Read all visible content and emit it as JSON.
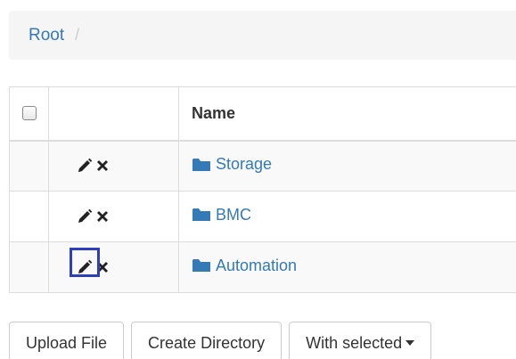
{
  "breadcrumb": {
    "root_label": "Root",
    "separator": "/"
  },
  "table": {
    "header": {
      "name_label": "Name"
    },
    "rows": [
      {
        "name": "Storage",
        "icon": "folder-icon"
      },
      {
        "name": "BMC",
        "icon": "folder-icon"
      },
      {
        "name": "Automation",
        "icon": "folder-icon"
      }
    ],
    "action_icons": [
      "pencil-icon",
      "times-icon"
    ]
  },
  "buttons": {
    "upload_label": "Upload File",
    "create_dir_label": "Create Directory",
    "with_selected_label": "With selected"
  },
  "colors": {
    "link": "#337ab7",
    "highlight": "#2f3fb8",
    "breadcrumb_bg": "#f5f5f5",
    "stripe_bg": "#f9f9f9"
  }
}
